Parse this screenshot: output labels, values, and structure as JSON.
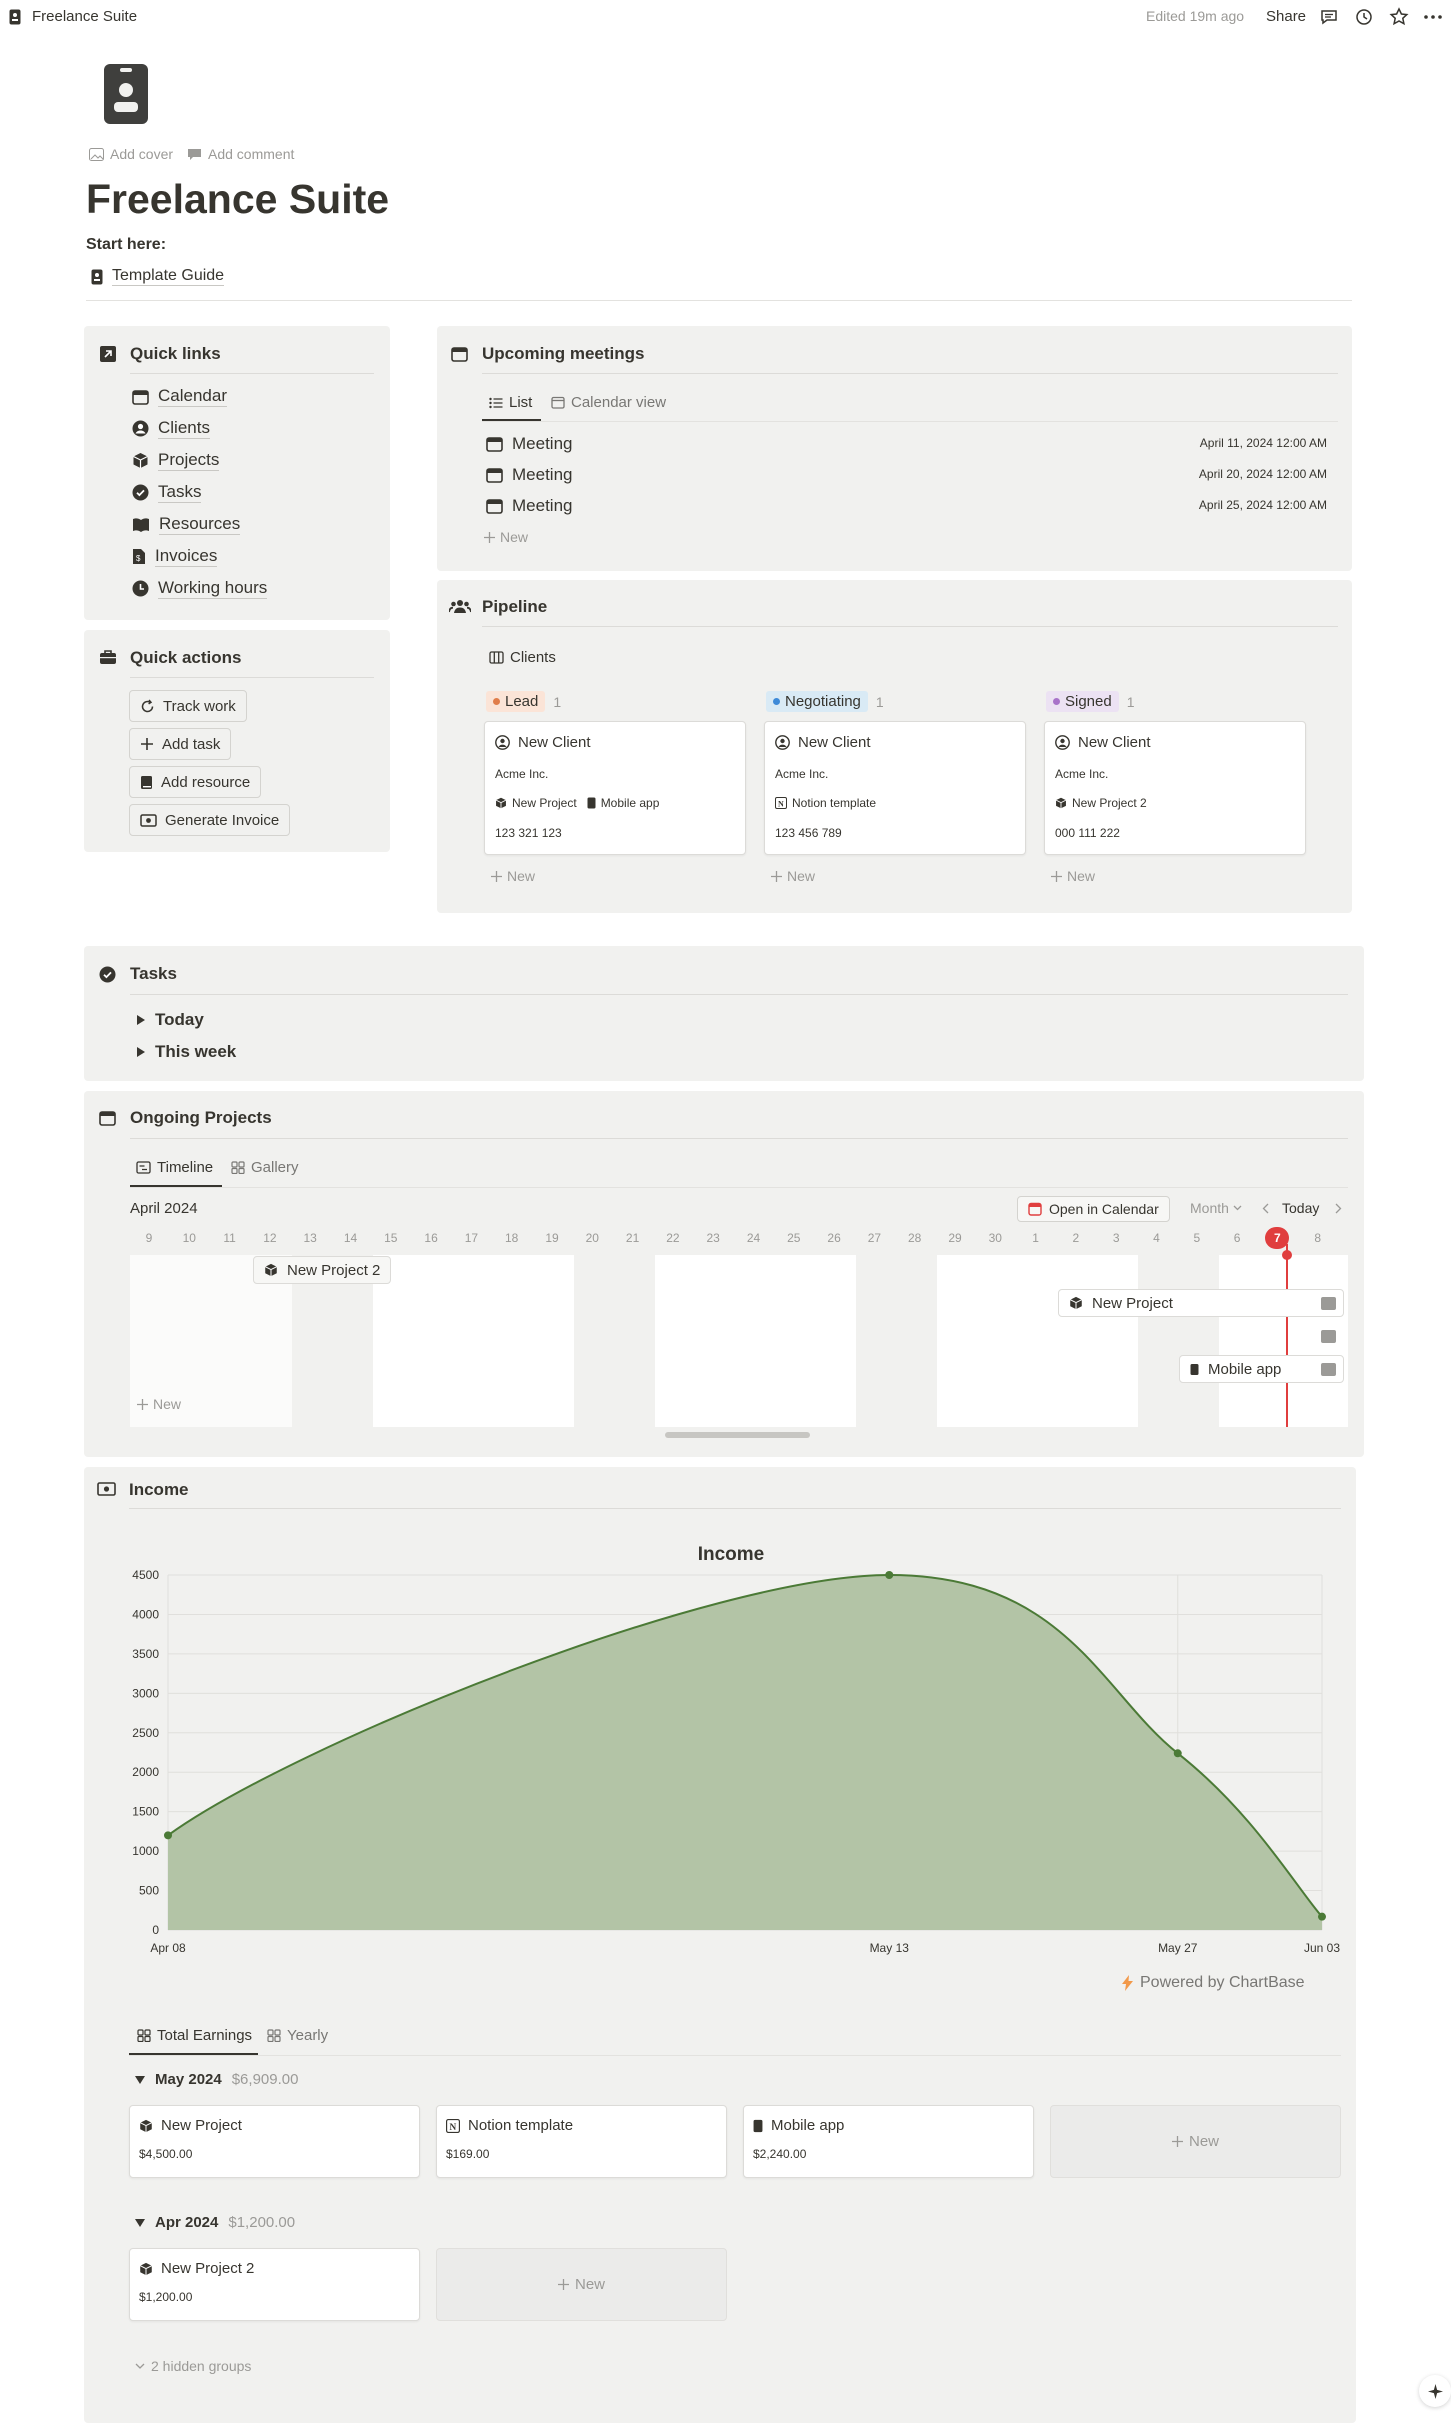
{
  "topbar": {
    "breadcrumb": "Freelance Suite",
    "edited": "Edited 19m ago",
    "share": "Share"
  },
  "header": {
    "add_cover": "Add cover",
    "add_comment": "Add comment",
    "title": "Freelance Suite",
    "start_here": "Start here:",
    "guide_link": "Template Guide"
  },
  "quick_links": {
    "title": "Quick links",
    "items": [
      "Calendar",
      "Clients",
      "Projects",
      "Tasks",
      "Resources",
      "Invoices",
      "Working hours"
    ]
  },
  "quick_actions": {
    "title": "Quick actions",
    "buttons": [
      "Track work",
      "Add task",
      "Add resource",
      "Generate Invoice"
    ]
  },
  "meetings": {
    "title": "Upcoming meetings",
    "tabs": [
      "List",
      "Calendar view"
    ],
    "rows": [
      {
        "name": "Meeting",
        "date": "April 11, 2024 12:00 AM"
      },
      {
        "name": "Meeting",
        "date": "April 20, 2024 12:00 AM"
      },
      {
        "name": "Meeting",
        "date": "April 25, 2024 12:00 AM"
      }
    ],
    "new": "New"
  },
  "pipeline": {
    "title": "Pipeline",
    "tab": "Clients",
    "columns": [
      {
        "status": "Lead",
        "count": "1",
        "bg": "#fbe4d7",
        "dot": "#e07d4a",
        "card": {
          "name": "New Client",
          "company": "Acme Inc.",
          "rel1": "New Project",
          "rel2": "Mobile app",
          "phone": "123 321 123"
        }
      },
      {
        "status": "Negotiating",
        "count": "1",
        "bg": "#d9eaf5",
        "dot": "#3e8ad8",
        "card": {
          "name": "New Client",
          "company": "Acme Inc.",
          "rel1": "Notion template",
          "rel2": "",
          "phone": "123 456 789"
        }
      },
      {
        "status": "Signed",
        "count": "1",
        "bg": "#ece2f3",
        "dot": "#a873c9",
        "card": {
          "name": "New Client",
          "company": "Acme Inc.",
          "rel1": "New Project 2",
          "rel2": "",
          "phone": "000 111 222"
        }
      }
    ],
    "new": "New"
  },
  "tasks": {
    "title": "Tasks",
    "groups": [
      "Today",
      "This week"
    ]
  },
  "projects": {
    "title": "Ongoing Projects",
    "tabs": [
      "Timeline",
      "Gallery"
    ],
    "month": "April 2024",
    "open_calendar": "Open in Calendar",
    "range": "Month",
    "today": "Today",
    "days": [
      "9",
      "10",
      "11",
      "12",
      "13",
      "14",
      "15",
      "16",
      "17",
      "18",
      "19",
      "20",
      "21",
      "22",
      "23",
      "24",
      "25",
      "26",
      "27",
      "28",
      "29",
      "30",
      "1",
      "2",
      "3",
      "4",
      "5",
      "6",
      "7",
      "8"
    ],
    "today_day": "7",
    "bars": [
      "New Project 2",
      "New Project",
      "Mobile app"
    ],
    "new": "New"
  },
  "income": {
    "title": "Income",
    "powered": "Powered by ChartBase",
    "tabs": [
      "Total Earnings",
      "Yearly"
    ],
    "groups": [
      {
        "title": "May 2024",
        "sum": "$6,909.00",
        "cards": [
          {
            "name": "New Project",
            "amount": "$4,500.00"
          },
          {
            "name": "Notion template",
            "amount": "$169.00"
          },
          {
            "name": "Mobile app",
            "amount": "$2,240.00"
          }
        ]
      },
      {
        "title": "Apr 2024",
        "sum": "$1,200.00",
        "cards": [
          {
            "name": "New Project 2",
            "amount": "$1,200.00"
          }
        ]
      }
    ],
    "new": "New",
    "hidden_groups": "2 hidden groups"
  },
  "chart_data": {
    "type": "area",
    "title": "Income",
    "x": [
      "Apr 08",
      "May 13",
      "May 27",
      "Jun 03"
    ],
    "x_days": [
      0,
      35,
      49,
      56
    ],
    "series": [
      {
        "values": [
          1200,
          4500,
          2240,
          169
        ]
      }
    ],
    "xlabel": "",
    "ylabel": "",
    "ylim": [
      0,
      4500
    ],
    "yticks": [
      0,
      500,
      1000,
      1500,
      2000,
      2500,
      3000,
      3500,
      4000,
      4500
    ],
    "grid": true,
    "line_color": "#4b7a36",
    "fill_color": "#b3c4a6"
  }
}
